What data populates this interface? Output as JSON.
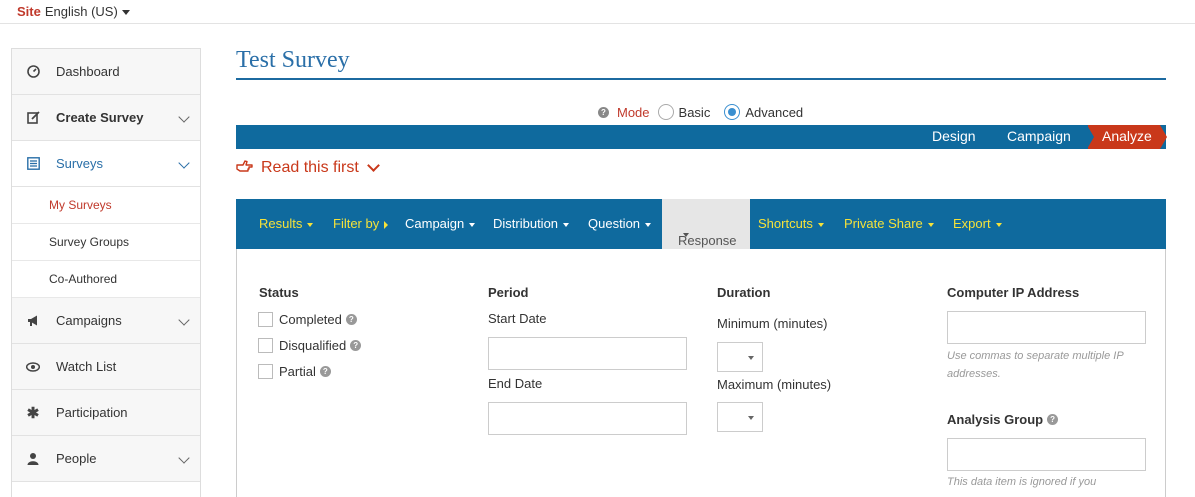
{
  "topbar": {
    "site_word": "Site",
    "language": "English (US)"
  },
  "sidebar": {
    "items": [
      {
        "label": "Dashboard"
      },
      {
        "label": "Create Survey"
      },
      {
        "label": "Surveys"
      },
      {
        "label": "My Surveys"
      },
      {
        "label": "Survey Groups"
      },
      {
        "label": "Co-Authored"
      },
      {
        "label": "Campaigns"
      },
      {
        "label": "Watch List"
      },
      {
        "label": "Participation"
      },
      {
        "label": "People"
      }
    ]
  },
  "page": {
    "title": "Test Survey"
  },
  "mode": {
    "label": "Mode",
    "basic": "Basic",
    "advanced": "Advanced",
    "selected": "Advanced"
  },
  "steps": {
    "design": "Design",
    "campaign": "Campaign",
    "analyze": "Analyze"
  },
  "read_first": "Read this first",
  "toolbar": {
    "results": "Results",
    "filter_by": "Filter by",
    "campaign": "Campaign",
    "distribution": "Distribution",
    "question": "Question",
    "response": "Response",
    "shortcuts": "Shortcuts",
    "private_share": "Private Share",
    "export": "Export"
  },
  "filters": {
    "status": {
      "heading": "Status",
      "completed": "Completed",
      "disqualified": "Disqualified",
      "partial": "Partial"
    },
    "period": {
      "heading": "Period",
      "start_date": "Start Date",
      "end_date": "End Date"
    },
    "duration": {
      "heading": "Duration",
      "minimum": "Minimum (minutes)",
      "maximum": "Maximum (minutes)"
    },
    "ip": {
      "heading": "Computer IP Address",
      "hint_line1": "Use commas to separate multiple IP",
      "hint_line2": "addresses."
    },
    "analysis_group": {
      "heading": "Analysis Group",
      "hint_line1": "This data item is ignored if you"
    }
  },
  "colors": {
    "brand_blue": "#0f6a9e",
    "accent_red": "#c9381a",
    "toolbar_yellow": "#f5e23a",
    "title_blue": "#2a6fa8"
  }
}
